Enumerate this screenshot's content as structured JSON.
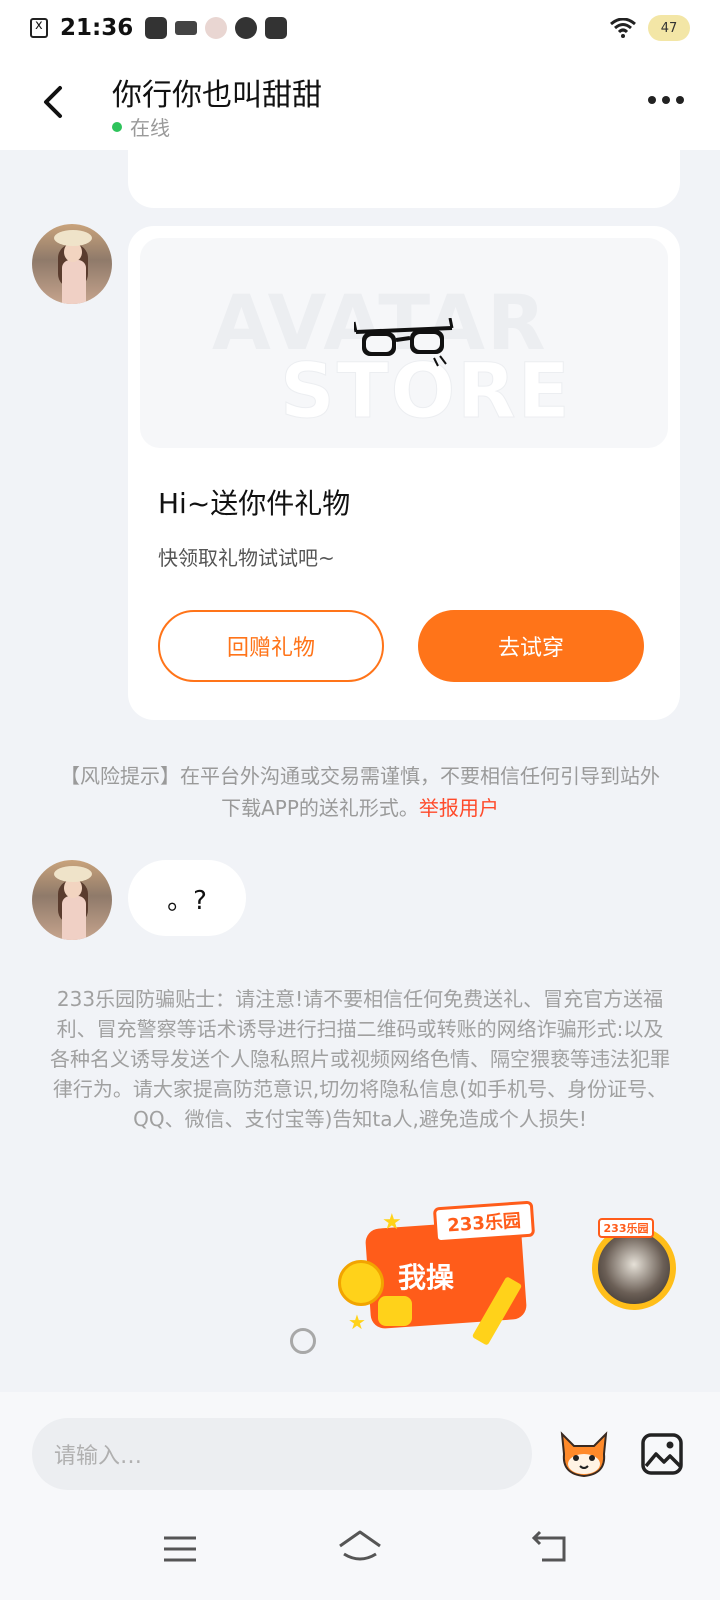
{
  "status_bar": {
    "time": "21:36",
    "battery": "47",
    "icons": [
      "sim-off-icon",
      "app-icon",
      "vivo-icon",
      "avatar-app-icon",
      "sync-icon",
      "link-icon",
      "wifi-icon",
      "battery-icon"
    ]
  },
  "header": {
    "title": "你行你也叫甜甜",
    "status": "在线",
    "back_icon": "chevron-left-icon",
    "more_icon": "more-dots-icon"
  },
  "gift_card": {
    "banner_line1": "AVATAR",
    "banner_line2": "STORE",
    "item_icon": "glasses-icon",
    "title": "Hi~送你件礼物",
    "subtitle": "快领取礼物试试吧~",
    "return_gift_label": "回赠礼物",
    "try_on_label": "去试穿"
  },
  "risk_notice": {
    "text": "【风险提示】在平台外沟通或交易需谨慎，不要相信任何引导到站外下载APP的送礼形式。",
    "link": "举报用户"
  },
  "message": {
    "text": "。?"
  },
  "fraud_notice": {
    "text": "233乐园防骗贴士：请注意!请不要相信任何免费送礼、冒充官方送福利、冒充警察等话术诱导进行扫描二维码或转账的网络诈骗形式:以及各种名义诱导发送个人隐私照片或视频网络色情、隔空猥亵等违法犯罪律行为。请大家提高防范意识,切勿将隐私信息(如手机号、身份证号、QQ、微信、支付宝等)告知ta人,避免造成个人损失!"
  },
  "sticker": {
    "brand": "233乐园",
    "text": "我操"
  },
  "my_avatar": {
    "tag": "233乐园"
  },
  "input": {
    "placeholder": "请输入…"
  },
  "colors": {
    "accent": "#ff7419",
    "online": "#2ec35b",
    "link_red": "#ff4a2a",
    "background": "#f1f3f7"
  }
}
